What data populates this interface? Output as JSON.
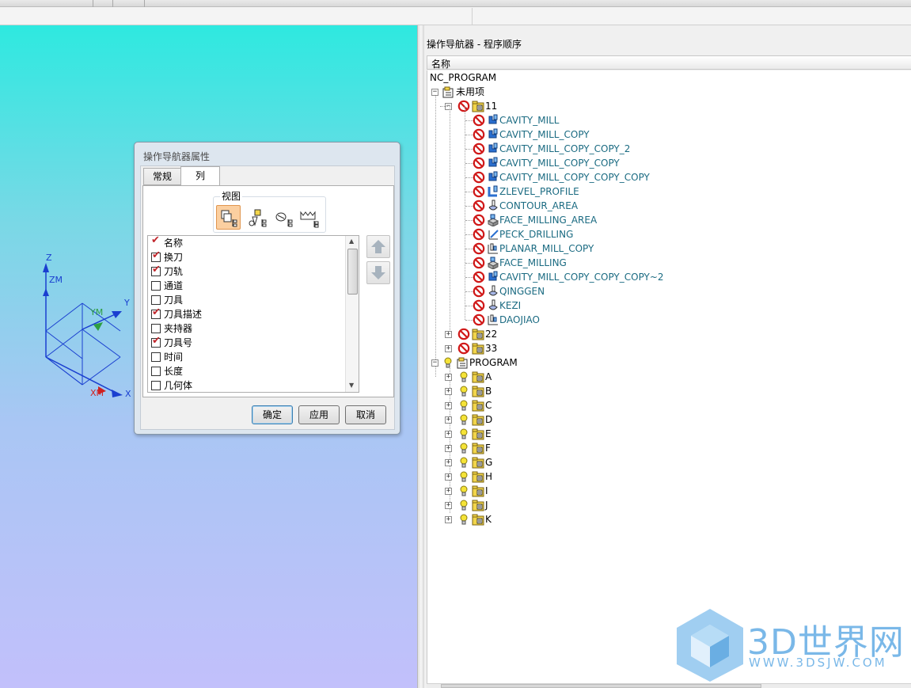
{
  "navigator": {
    "title": "操作导航器 - 程序顺序",
    "column_header": "名称",
    "root": "NC_PROGRAM",
    "unused": "未用项",
    "group_11": "11",
    "operations": [
      {
        "name": "CAVITY_MILL",
        "icon": "cavity-mill-icon"
      },
      {
        "name": "CAVITY_MILL_COPY",
        "icon": "cavity-mill-icon"
      },
      {
        "name": "CAVITY_MILL_COPY_COPY_2",
        "icon": "cavity-mill-icon"
      },
      {
        "name": "CAVITY_MILL_COPY_COPY",
        "icon": "cavity-mill-icon"
      },
      {
        "name": "CAVITY_MILL_COPY_COPY_COPY",
        "icon": "cavity-mill-icon"
      },
      {
        "name": "ZLEVEL_PROFILE",
        "icon": "zlevel-profile-icon"
      },
      {
        "name": "CONTOUR_AREA",
        "icon": "contour-area-icon"
      },
      {
        "name": "FACE_MILLING_AREA",
        "icon": "face-milling-icon"
      },
      {
        "name": "PECK_DRILLING",
        "icon": "drilling-icon"
      },
      {
        "name": "PLANAR_MILL_COPY",
        "icon": "planar-mill-icon"
      },
      {
        "name": "FACE_MILLING",
        "icon": "face-milling-icon"
      },
      {
        "name": "CAVITY_MILL_COPY_COPY_COPY~2",
        "icon": "cavity-mill-icon"
      },
      {
        "name": "QINGGEN",
        "icon": "contour-area-icon"
      },
      {
        "name": "KEZI",
        "icon": "contour-area-icon"
      },
      {
        "name": "DAOJIAO",
        "icon": "planar-mill-icon"
      }
    ],
    "group_22": "22",
    "group_33": "33",
    "program": "PROGRAM",
    "program_children": [
      "A",
      "B",
      "C",
      "D",
      "E",
      "F",
      "G",
      "H",
      "I",
      "J",
      "K"
    ]
  },
  "dialog": {
    "title": "操作导航器属性",
    "tabs": [
      "常规",
      "列"
    ],
    "active_tab": "列",
    "view_group_label": "视图",
    "columns": [
      {
        "label": "名称",
        "checked": true
      },
      {
        "label": "换刀",
        "checked": true
      },
      {
        "label": "刀轨",
        "checked": true
      },
      {
        "label": "通道",
        "checked": false
      },
      {
        "label": "刀具",
        "checked": false
      },
      {
        "label": "刀具描述",
        "checked": true
      },
      {
        "label": "夹持器",
        "checked": false
      },
      {
        "label": "刀具号",
        "checked": true
      },
      {
        "label": "时间",
        "checked": false
      },
      {
        "label": "长度",
        "checked": false
      },
      {
        "label": "几何体",
        "checked": false
      }
    ],
    "ok": "确定",
    "apply": "应用",
    "cancel": "取消"
  },
  "viewport": {
    "axes": {
      "z": "Z",
      "zm": "ZM",
      "y": "Y",
      "ym": "YM",
      "x": "X",
      "xm": "XM"
    }
  },
  "watermark": {
    "text": "3D世界网",
    "url": "WWW.3DSJW.COM"
  },
  "colors": {
    "operation_text": "#1b6b82",
    "prohibit_red": "#d01818",
    "folder_yellow": "#f2d54a",
    "check_red": "#c1272d"
  }
}
